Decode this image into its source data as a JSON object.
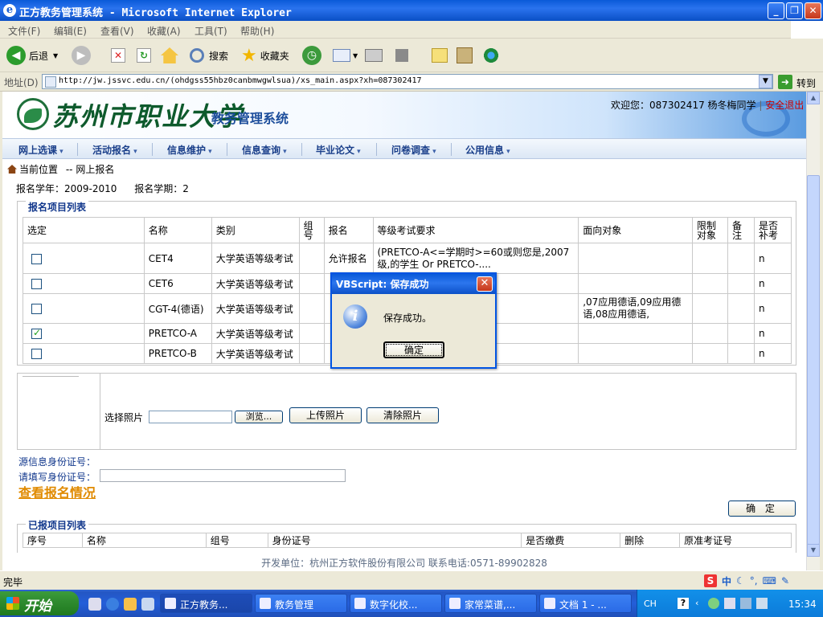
{
  "window": {
    "title": "正方教务管理系统 - Microsoft Internet Explorer",
    "min": "_",
    "max": "❐",
    "close": "✕"
  },
  "menu": [
    "文件(F)",
    "编辑(E)",
    "查看(V)",
    "收藏(A)",
    "工具(T)",
    "帮助(H)"
  ],
  "toolbar": {
    "back": "后退",
    "search": "搜索",
    "favorites": "收藏夹"
  },
  "address": {
    "label": "地址(D)",
    "url": "http://jw.jssvc.edu.cn/(ohdgss55hbz0canbmwgwlsua)/xs_main.aspx?xh=087302417",
    "go": "转到"
  },
  "header": {
    "school": "苏州市职业大学",
    "system": "教务管理系统",
    "welcome": "欢迎您：087302417 杨冬梅同学",
    "logout": "安全退出"
  },
  "nav": [
    "网上选课",
    "活动报名",
    "信息维护",
    "信息查询",
    "毕业论文",
    "问卷调查",
    "公用信息"
  ],
  "breadcrumb": {
    "current": "当前位置",
    "page": "-- 网上报名"
  },
  "term": {
    "year": "报名学年：2009-2010",
    "term": "报名学期：2"
  },
  "signup": {
    "legend": "报名项目列表",
    "headers": [
      "选定",
      "名称",
      "类别",
      "组号",
      "报名",
      "等级考试要求",
      "面向对象",
      "限制对象",
      "备注",
      "是否补考"
    ],
    "rows": [
      {
        "checked": false,
        "name": "CET4",
        "type": "大学英语等级考试",
        "group": "",
        "enroll": "允许报名",
        "req": "(PRETCO-A<=学期时>=60或则您是,2007级,的学生 Or PRETCO-....",
        "target": "",
        "limit": "",
        "note": "",
        "makeup": "n"
      },
      {
        "checked": false,
        "name": "CET6",
        "type": "大学英语等级考试",
        "group": "",
        "enroll": "",
        "req": "",
        "target": "",
        "limit": "",
        "note": "",
        "makeup": "n"
      },
      {
        "checked": false,
        "name": "CGT-4(德语)",
        "type": "大学英语等级考试",
        "group": "",
        "enroll": "",
        "req": "",
        "target": ",07应用德语,09应用德语,08应用德语,",
        "limit": "",
        "note": "",
        "makeup": "n"
      },
      {
        "checked": true,
        "name": "PRETCO-A",
        "type": "大学英语等级考试",
        "group": "",
        "enroll": "",
        "req": "",
        "target": "",
        "limit": "",
        "note": "",
        "makeup": "n"
      },
      {
        "checked": false,
        "name": "PRETCO-B",
        "type": "大学英语等级考试",
        "group": "",
        "enroll": "",
        "req": "",
        "target": "",
        "limit": "",
        "note": "",
        "makeup": "n"
      }
    ]
  },
  "photo": {
    "label": "选择照片",
    "browse": "浏览...",
    "upload": "上传照片",
    "clear": "清除照片"
  },
  "id": {
    "source_label": "源信息身份证号：",
    "fill_label": "请填写身份证号：",
    "view_link": "查看报名情况",
    "confirm": "确 定"
  },
  "registered": {
    "legend": "已报项目列表",
    "headers": [
      "序号",
      "名称",
      "组号",
      "身份证号",
      "是否缴费",
      "删除",
      "原准考证号"
    ]
  },
  "footer": "开发单位：杭州正方软件股份有限公司 联系电话:0571-89902828",
  "status": {
    "text": "完毕",
    "ime": "中"
  },
  "dialog": {
    "title": "VBScript: 保存成功",
    "message": "保存成功。",
    "ok": "确定"
  },
  "taskbar": {
    "start": "开始",
    "tasks": [
      "正方教务...",
      "教务管理",
      "数字化校...",
      "家常菜谱,...",
      "文档 1 - ..."
    ],
    "lang": "CH",
    "clock": "15:34"
  },
  "colors": {
    "xp_blue": "#0054e3",
    "nav_text": "#1a3f8a",
    "legend_text": "#11378c",
    "view_link": "#e08a00",
    "logout": "#cc0000"
  }
}
